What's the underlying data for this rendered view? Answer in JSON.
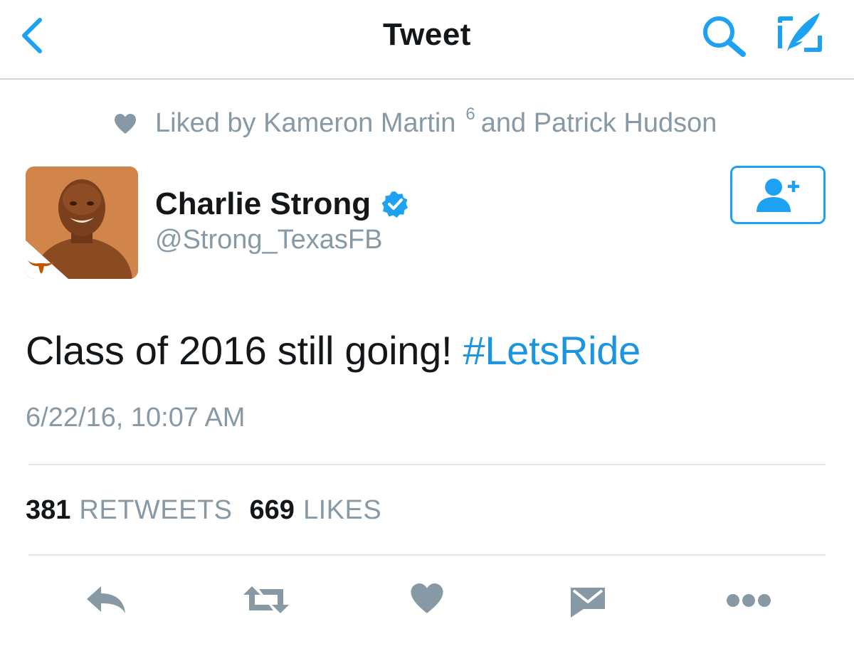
{
  "nav": {
    "title": "Tweet",
    "back_icon": "chevron-left-icon",
    "search_icon": "search-icon",
    "compose_icon": "compose-icon"
  },
  "social_context": {
    "prefix": "Liked by Kameron Martin",
    "superscript": "6",
    "suffix": "and Patrick Hudson"
  },
  "author": {
    "display_name": "Charlie Strong",
    "handle": "@Strong_TexasFB",
    "verified": true
  },
  "follow_button": {
    "icon": "add-user-icon"
  },
  "tweet": {
    "text": "Class of 2016 still going! ",
    "hashtag": "#LetsRide",
    "timestamp": "6/22/16, 10:07 AM"
  },
  "stats": {
    "retweets_count": "381",
    "retweets_label": "RETWEETS",
    "likes_count": "669",
    "likes_label": "LIKES"
  },
  "actions": [
    "reply-icon",
    "retweet-icon",
    "like-icon",
    "direct-message-icon",
    "more-icon"
  ],
  "colors": {
    "accent": "#1da1f2",
    "hashtag": "#1b95e0",
    "secondary_text": "#8899a6",
    "primary_text": "#14171a",
    "icon_gray": "#8899a6",
    "avatar_tint": "#c97a3f"
  }
}
